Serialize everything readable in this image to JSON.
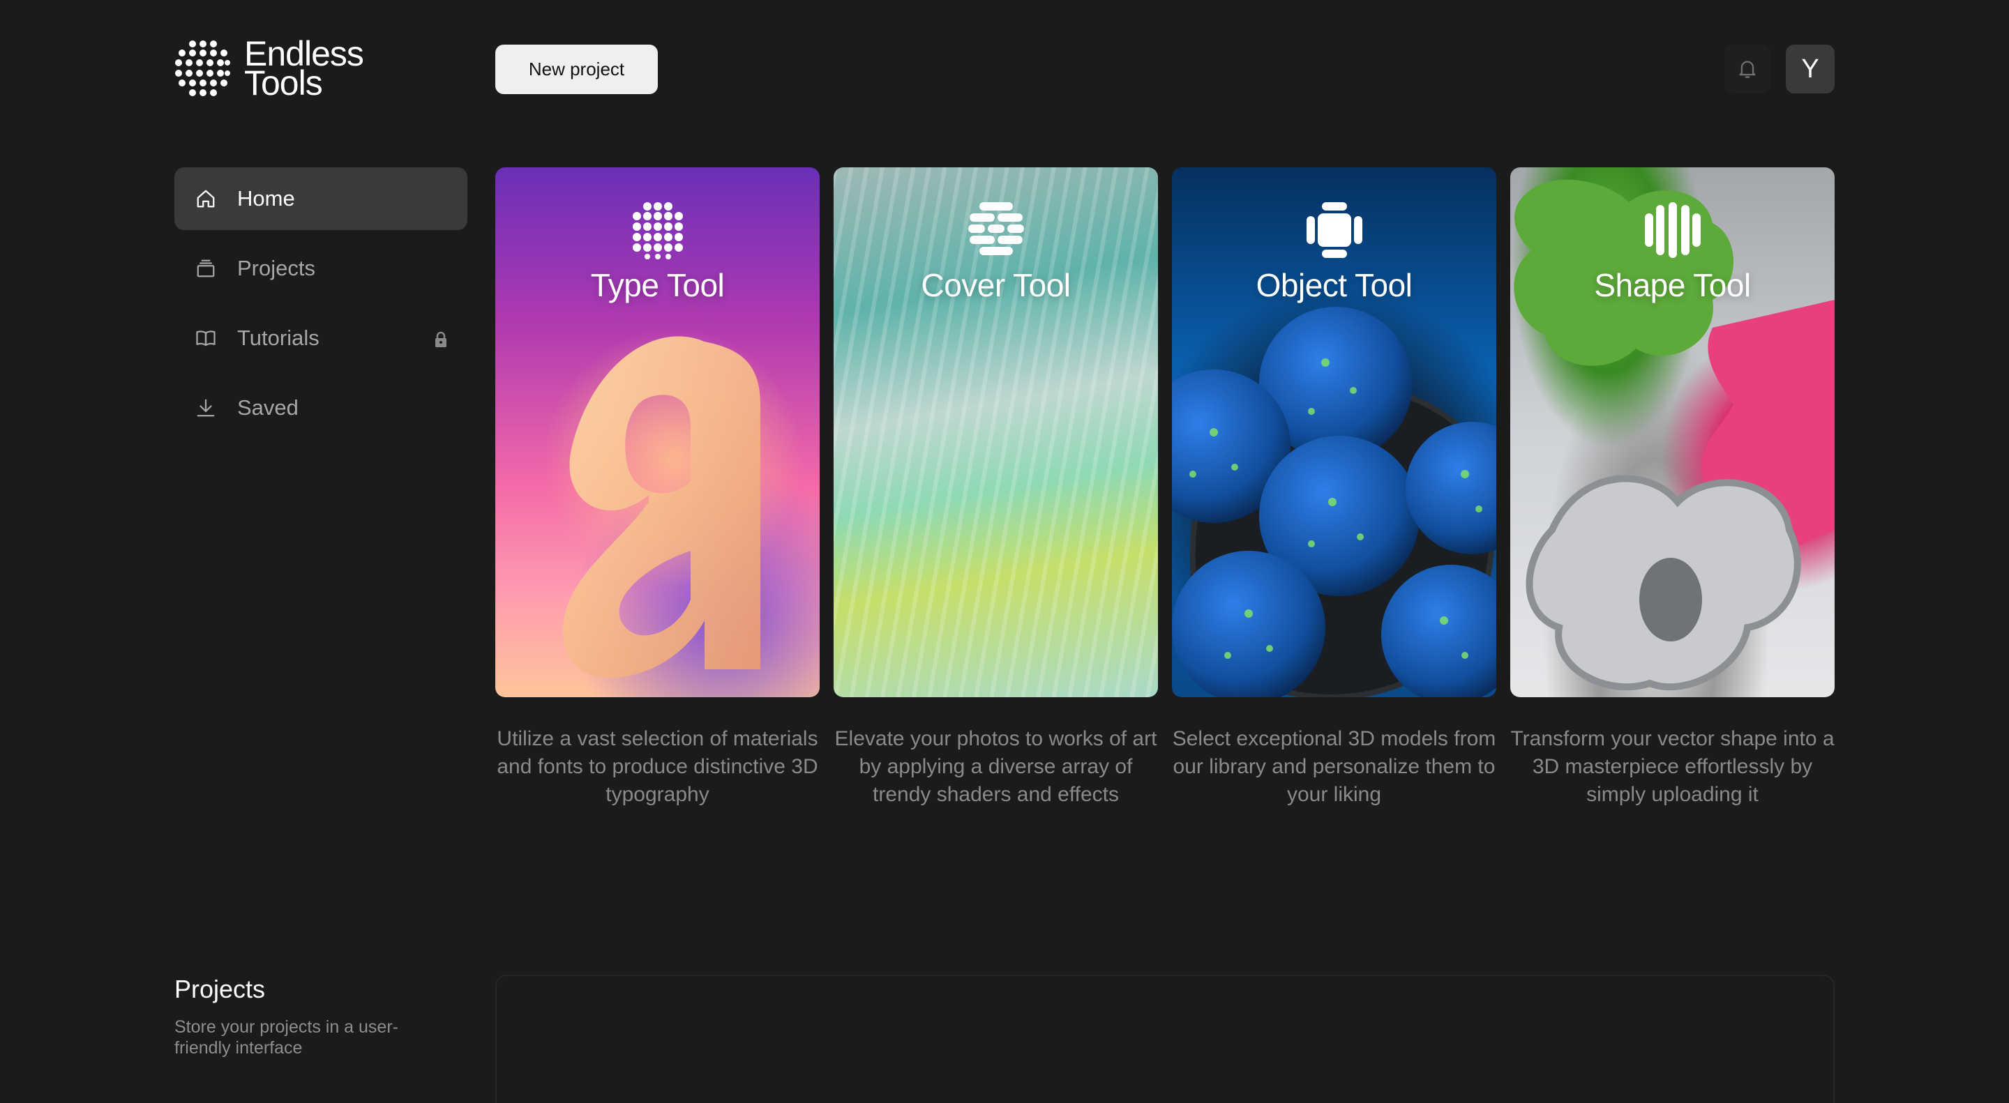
{
  "brand": {
    "line1": "Endless",
    "line2": "Tools"
  },
  "header": {
    "new_project_label": "New project",
    "avatar_initial": "Y"
  },
  "sidebar": {
    "items": [
      {
        "label": "Home",
        "icon": "home-icon",
        "active": true
      },
      {
        "label": "Projects",
        "icon": "projects-icon"
      },
      {
        "label": "Tutorials",
        "icon": "book-icon",
        "locked": true
      },
      {
        "label": "Saved",
        "icon": "download-icon"
      }
    ]
  },
  "tools": [
    {
      "title": "Type Tool",
      "description": "Utilize a vast selection of materials and fonts to produce distinctive 3D typography"
    },
    {
      "title": "Cover Tool",
      "description": "Elevate your photos to works of art by applying a diverse array of trendy shaders and effects"
    },
    {
      "title": "Object Tool",
      "description": "Select exceptional 3D models from our library and personalize them to your liking"
    },
    {
      "title": "Shape Tool",
      "description": "Transform your vector shape into a 3D masterpiece effortlessly by simply uploading it"
    }
  ],
  "projects_section": {
    "title": "Projects",
    "subtitle": "Store your projects in a user-friendly interface"
  }
}
